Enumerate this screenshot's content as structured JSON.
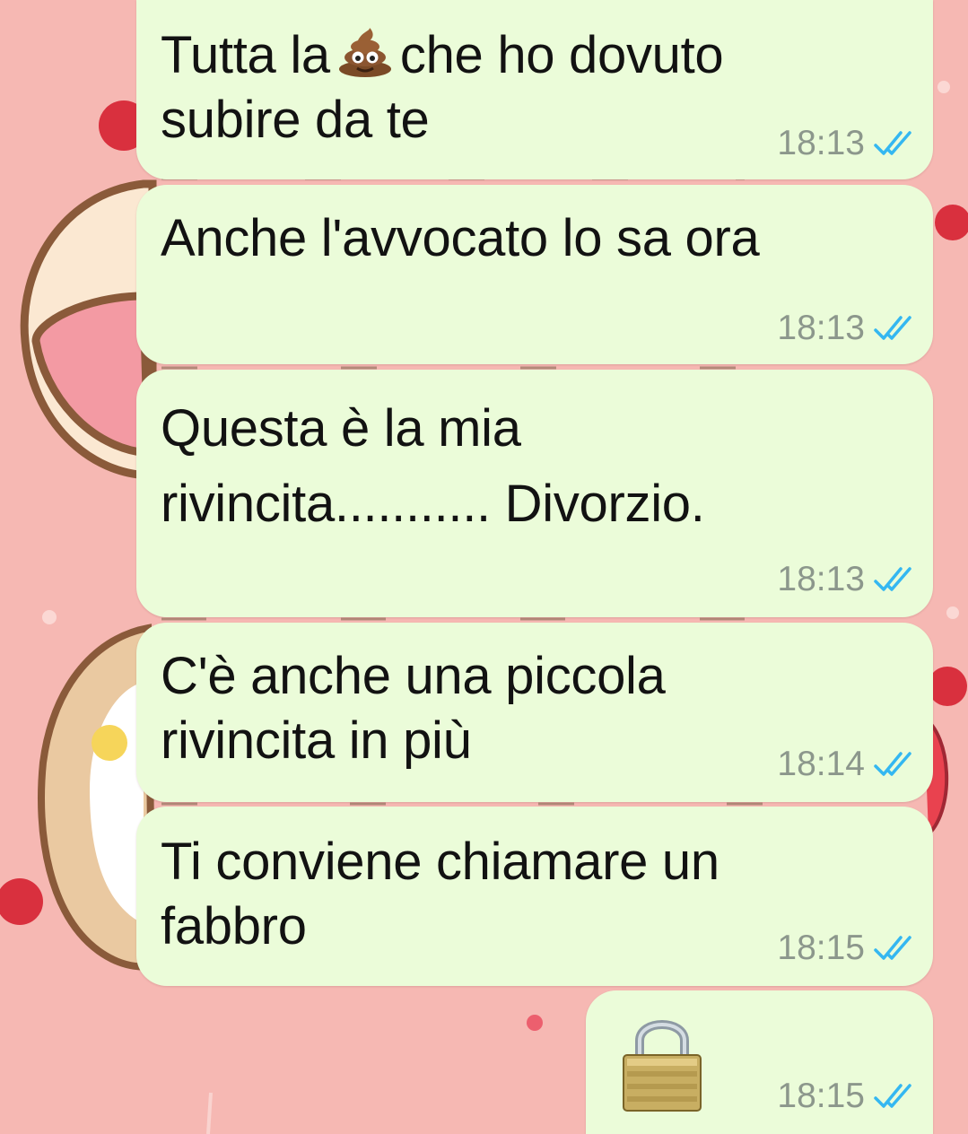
{
  "chat": {
    "messages": [
      {
        "text_before_emoji": "Tutta la",
        "emoji": "pile-of-poo",
        "text_after_emoji": "che ho dovuto\nsubire da te",
        "time": "18:13",
        "status": "read"
      },
      {
        "text": "Anche l'avvocato lo sa ora",
        "time": "18:13",
        "status": "read"
      },
      {
        "text": "Questa è la mia\nrivincita........... Divorzio.",
        "time": "18:13",
        "status": "read"
      },
      {
        "text": "C'è anche una piccola\nrivincita in più",
        "time": "18:14",
        "status": "read"
      },
      {
        "text": "Ti conviene chiamare un\nfabbro",
        "time": "18:15",
        "status": "read"
      },
      {
        "emoji": "padlock",
        "time": "18:15",
        "status": "read"
      }
    ]
  },
  "theme": {
    "background": "#f6b8b3",
    "outgoing_bubble": "#ebfcd9",
    "text": "#121212",
    "timestamp": "#8c978c",
    "read_ticks": "#34b7f1"
  },
  "icons": {
    "read_receipt": "double-check-icon",
    "inline_emoji": "pile-of-poo-icon",
    "sticker_emoji": "padlock-icon"
  }
}
